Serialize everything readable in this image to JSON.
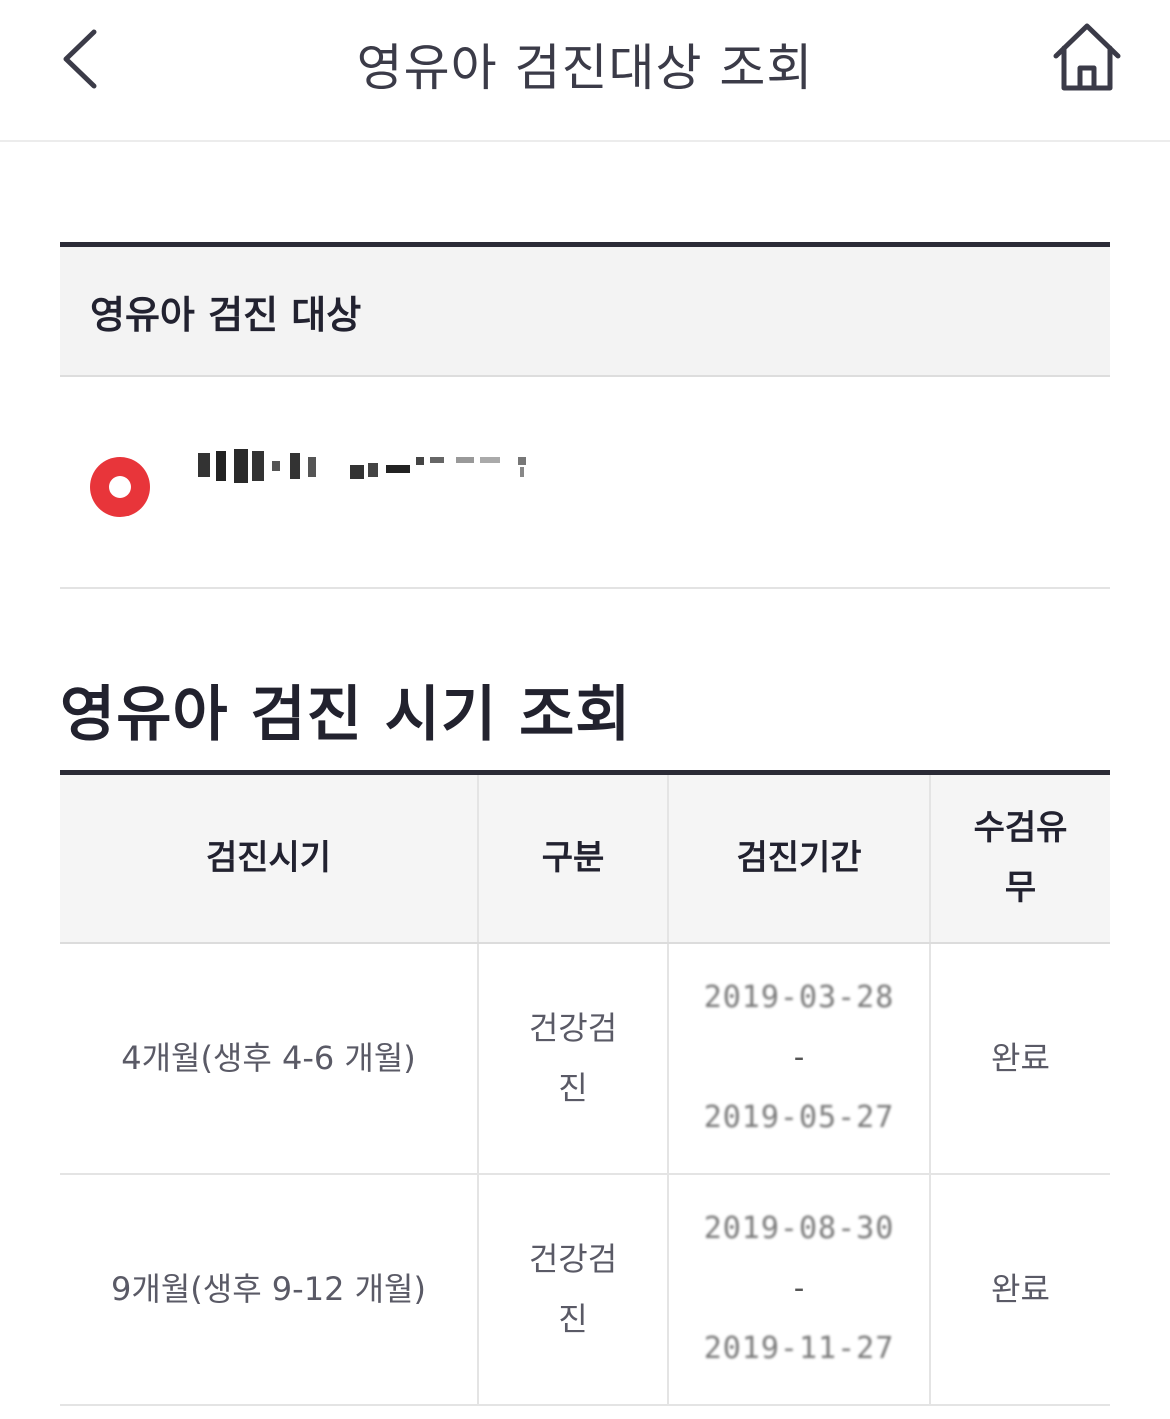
{
  "appbar": {
    "title": "영유아 검진대상 조회",
    "back_icon": "chevron-left-icon",
    "home_icon": "home-icon"
  },
  "target": {
    "header": "영유아 검진 대상",
    "selected_name": "",
    "radio_color": "#e8353a"
  },
  "schedule": {
    "title": "영유아 검진 시기 조회",
    "columns": [
      "검진시기",
      "구분",
      "검진기간",
      "수검유무"
    ],
    "rows": [
      {
        "period_label": "4개월(생후 4-6 개월)",
        "category": "건강검진",
        "range_start": "2019-03-28",
        "range_sep": "-",
        "range_end": "2019-05-27",
        "status": "완료"
      },
      {
        "period_label": "9개월(생후 9-12 개월)",
        "category": "건강검진",
        "range_start": "2019-08-30",
        "range_sep": "-",
        "range_end": "2019-11-27",
        "status": "완료"
      }
    ]
  }
}
